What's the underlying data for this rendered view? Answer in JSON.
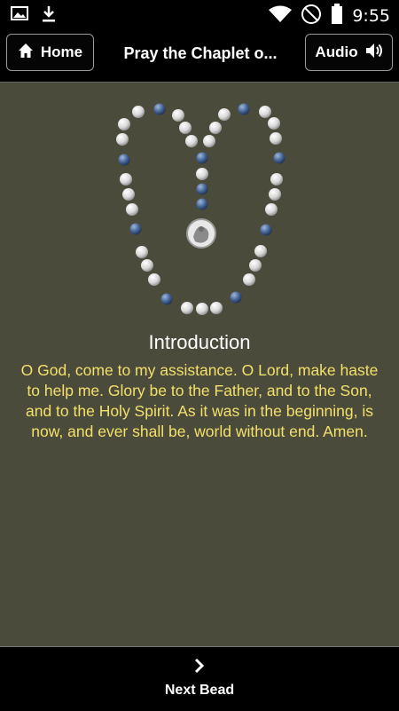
{
  "status_bar": {
    "time": "9:55",
    "icons": [
      "image-icon",
      "download-icon",
      "wifi-icon",
      "no-sim-icon",
      "battery-icon"
    ]
  },
  "header": {
    "home_label": "Home",
    "title": "Pray the Chaplet o...",
    "audio_label": "Audio"
  },
  "content": {
    "section_title": "Introduction",
    "prayer_text": "O God, come to my assistance. O Lord, make haste to help me. Glory be to the Father, and to the Son, and to the Holy Spirit. As it was in the beginning, is now, and ever shall be, world without end. Amen."
  },
  "footer": {
    "next_label": "Next Bead"
  },
  "colors": {
    "background": "#4b4b3b",
    "prayer_text": "#f3e06b",
    "bead_white": "#e6e6e6",
    "bead_blue": "#3f5f8f"
  }
}
